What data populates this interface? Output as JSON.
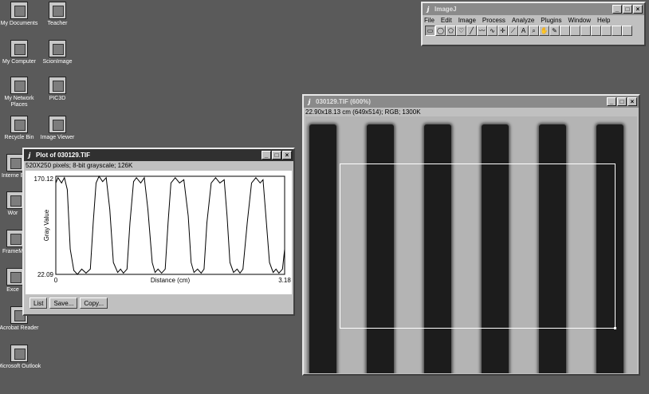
{
  "desktop": {
    "icons": [
      {
        "label": "My Documents",
        "icon": "my-documents-icon"
      },
      {
        "label": "Teacher",
        "icon": "teacher-folder-icon"
      },
      {
        "label": "My Computer",
        "icon": "my-computer-icon"
      },
      {
        "label": "ScionImage",
        "icon": "scionimage-icon"
      },
      {
        "label": "My Network Places",
        "icon": "network-places-icon"
      },
      {
        "label": "PIC3D",
        "icon": "pic3d-icon"
      },
      {
        "label": "Recycle Bin",
        "icon": "recycle-bin-icon"
      },
      {
        "label": "Image Viewer",
        "icon": "image-viewer-icon"
      },
      {
        "label": "Interne Explo",
        "icon": "internet-explorer-icon"
      },
      {
        "label": "Wor",
        "icon": "word-icon"
      },
      {
        "label": "FrameM",
        "icon": "framemaker-icon"
      },
      {
        "label": "Exce",
        "icon": "excel-icon"
      },
      {
        "label": "Acrobat Reader",
        "icon": "acrobat-reader-icon"
      },
      {
        "label": "Microsoft Outlook",
        "icon": "outlook-icon"
      }
    ]
  },
  "imagej": {
    "title": "ImageJ",
    "menus": [
      "File",
      "Edit",
      "Image",
      "Process",
      "Analyze",
      "Plugins",
      "Window",
      "Help"
    ],
    "tools": [
      {
        "name": "rectangle-tool",
        "glyph": "▭",
        "selected": true
      },
      {
        "name": "oval-tool",
        "glyph": "◯"
      },
      {
        "name": "polygon-tool",
        "glyph": "⬠"
      },
      {
        "name": "freehand-tool",
        "glyph": "♡"
      },
      {
        "name": "line-tool",
        "glyph": "╱"
      },
      {
        "name": "segmented-line-tool",
        "glyph": "〰"
      },
      {
        "name": "freehand-line-tool",
        "glyph": "∿"
      },
      {
        "name": "crosshair-tool",
        "glyph": "✛"
      },
      {
        "name": "wand-tool",
        "glyph": "⟋"
      },
      {
        "name": "text-tool",
        "glyph": "A"
      },
      {
        "name": "magnifier-tool",
        "glyph": "⌕"
      },
      {
        "name": "hand-tool",
        "glyph": "✋"
      },
      {
        "name": "color-picker-tool",
        "glyph": "✎"
      },
      {
        "name": "empty-tool-1",
        "glyph": ""
      },
      {
        "name": "empty-tool-2",
        "glyph": ""
      },
      {
        "name": "empty-tool-3",
        "glyph": ""
      },
      {
        "name": "empty-tool-4",
        "glyph": ""
      },
      {
        "name": "empty-tool-5",
        "glyph": ""
      },
      {
        "name": "empty-tool-6",
        "glyph": ""
      },
      {
        "name": "empty-tool-7",
        "glyph": ""
      }
    ]
  },
  "plot_window": {
    "title": "Plot of 030129.TIF",
    "info": "520X250 pixels; 8-bit grayscale; 126K",
    "buttons": [
      "List",
      "Save...",
      "Copy..."
    ]
  },
  "image_window": {
    "title": "030129.TIF (600%)",
    "info": "22.90x18.13 cm (649x514); RGB; 1300K",
    "bars": 6
  },
  "chart_data": {
    "type": "line",
    "title": "",
    "xlabel": "Distance (cm)",
    "ylabel": "Gray Value",
    "xlim": [
      0,
      3.18
    ],
    "ylim": [
      22.09,
      170.12
    ],
    "x_tick_labels": [
      "0",
      "3.18"
    ],
    "y_tick_labels": [
      "170.12",
      "22.09"
    ],
    "series": [
      {
        "x": [
          0,
          0.03,
          0.08,
          0.12,
          0.16,
          0.2,
          0.25,
          0.3,
          0.36,
          0.42,
          0.48,
          0.52,
          0.56,
          0.6,
          0.65,
          0.7,
          0.75,
          0.8,
          0.86,
          0.9,
          0.94,
          0.99,
          1.03,
          1.08,
          1.12,
          1.18,
          1.23,
          1.28,
          1.34,
          1.38,
          1.42,
          1.47,
          1.52,
          1.56,
          1.6,
          1.66,
          1.72,
          1.78,
          1.84,
          1.88,
          1.92,
          1.97,
          2.02,
          2.06,
          2.1,
          2.16,
          2.22,
          2.28,
          2.34,
          2.38,
          2.42,
          2.47,
          2.52,
          2.56,
          2.6,
          2.66,
          2.72,
          2.78,
          2.84,
          2.88,
          2.92,
          2.97,
          3.02,
          3.06,
          3.1,
          3.15,
          3.18
        ],
        "y": [
          160,
          168,
          160,
          168,
          150,
          60,
          28,
          22.09,
          30,
          24,
          30,
          100,
          160,
          170.12,
          162,
          168,
          120,
          40,
          25,
          30,
          24,
          30,
          100,
          162,
          168,
          160,
          168,
          120,
          40,
          25,
          30,
          24,
          30,
          100,
          160,
          168,
          160,
          165,
          110,
          40,
          25,
          30,
          24,
          30,
          100,
          160,
          168,
          160,
          165,
          110,
          40,
          25,
          30,
          24,
          30,
          100,
          160,
          168,
          160,
          165,
          110,
          40,
          25,
          30,
          24,
          30,
          60
        ]
      }
    ]
  }
}
